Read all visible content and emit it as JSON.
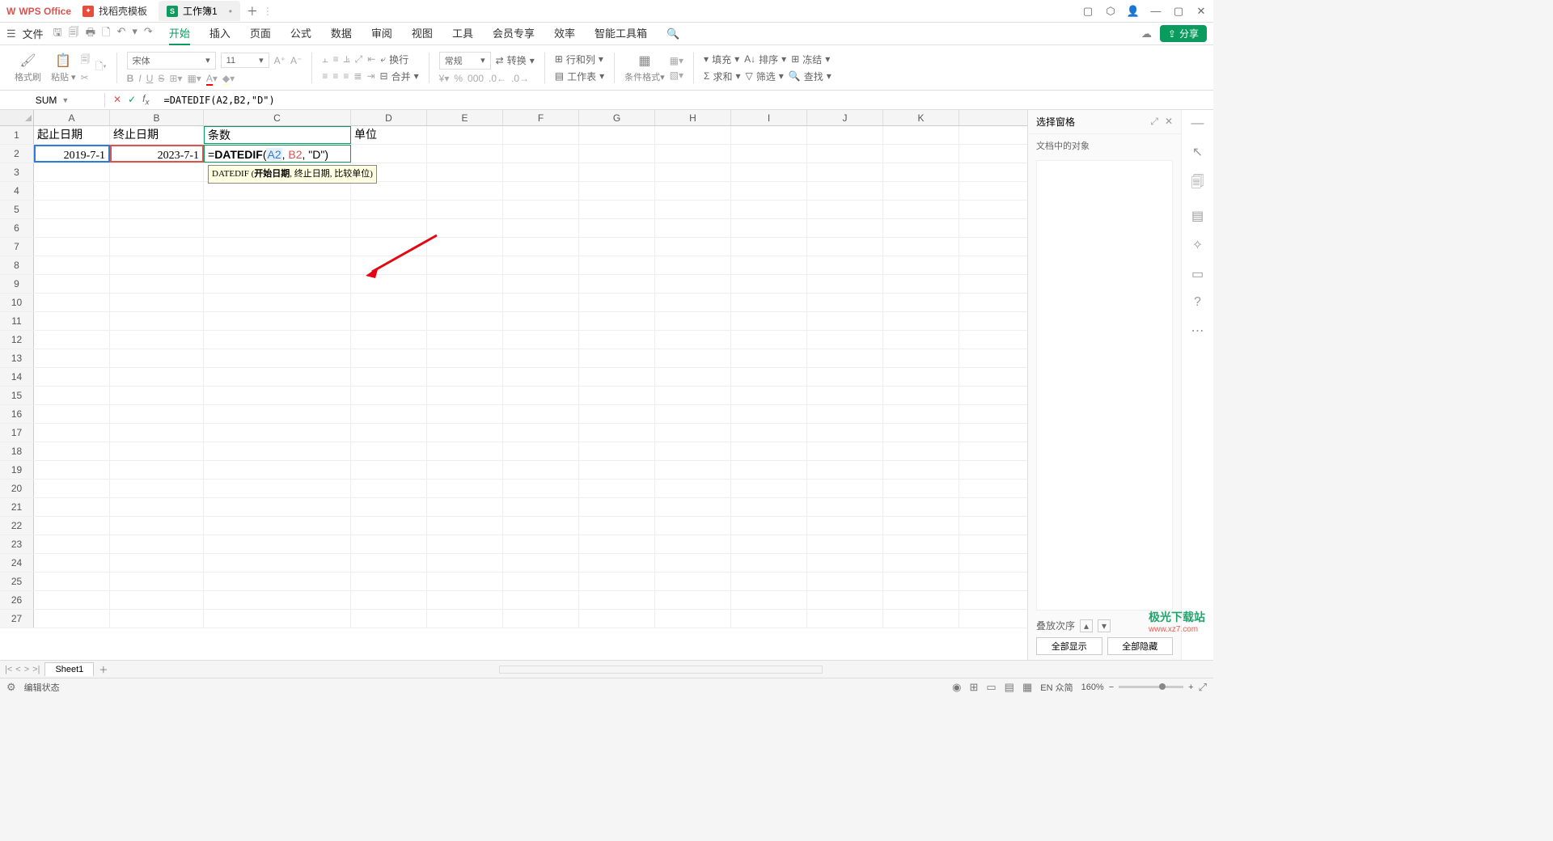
{
  "titlebar": {
    "app_name": "WPS Office",
    "template_tab": "找稻壳模板",
    "workbook_tab": "工作簿1",
    "workbook_icon": "S"
  },
  "menubar": {
    "file": "文件",
    "tabs": [
      "开始",
      "插入",
      "页面",
      "公式",
      "数据",
      "审阅",
      "视图",
      "工具",
      "会员专享",
      "效率",
      "智能工具箱"
    ],
    "share": "分享"
  },
  "ribbon": {
    "format_painter": "格式刷",
    "paste": "粘贴",
    "font_name": "宋体",
    "font_size": "11",
    "wrap": "换行",
    "merge": "合并",
    "number_format": "常规",
    "convert": "转换",
    "rows_cols": "行和列",
    "worksheet": "工作表",
    "cond_fmt": "条件格式",
    "fill": "填充",
    "sort": "排序",
    "freeze": "冻结",
    "sum": "求和",
    "filter": "筛选",
    "find": "查找"
  },
  "formula_bar": {
    "name_box": "SUM",
    "formula": "=DATEDIF(A2,B2,\"D\")"
  },
  "columns": [
    "A",
    "B",
    "C",
    "D",
    "E",
    "F",
    "G",
    "H",
    "I",
    "J",
    "K"
  ],
  "row_numbers": [
    "1",
    "2",
    "3",
    "4",
    "5",
    "6",
    "7",
    "8",
    "9",
    "10",
    "11",
    "12",
    "13",
    "14",
    "15",
    "16",
    "17",
    "18",
    "19",
    "20",
    "21",
    "22",
    "23",
    "24",
    "25",
    "26",
    "27"
  ],
  "sheet_data": {
    "r1": {
      "A": "起止日期",
      "B": "终止日期",
      "C": "条数",
      "D": "单位"
    },
    "r2": {
      "A": "2019-7-1",
      "B": "2023-7-1"
    },
    "formula_parts": {
      "eq": "=",
      "fn": "DATEDIF",
      "open": "(",
      "a2": "A2",
      "c1": ", ",
      "b2": "B2",
      "c2": ", ",
      "str": "\"D\"",
      "close": ")"
    },
    "tooltip": {
      "fn": "DATEDIF",
      "p1": "开始日期",
      "rest": ", 终止日期, 比较单位)"
    }
  },
  "right_panel": {
    "title": "选择窗格",
    "subtitle": "文档中的对象",
    "stack_order": "叠放次序",
    "show_all": "全部显示",
    "hide_all": "全部隐藏"
  },
  "sheet_tabs": {
    "sheet1": "Sheet1"
  },
  "statusbar": {
    "mode": "编辑状态",
    "ime": "EN 众简",
    "zoom": "160%"
  },
  "watermark": {
    "line1": "极光下载站",
    "line2": "www.xz7.com"
  }
}
